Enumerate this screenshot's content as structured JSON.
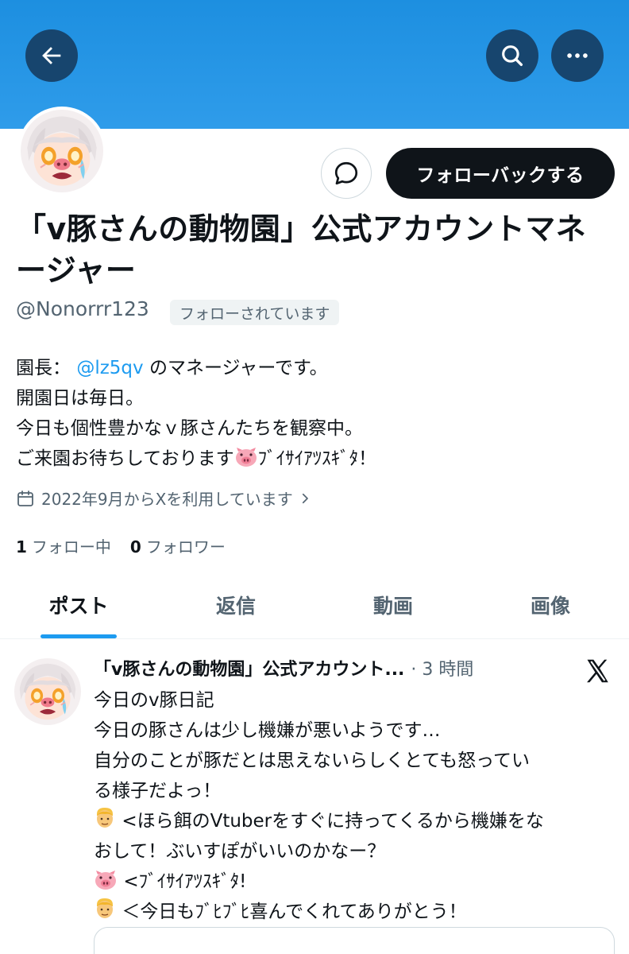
{
  "profile": {
    "display_name": "「v豚さんの動物園」公式アカウントマネージャー",
    "handle": "@Nonorrr123",
    "follows_you_badge": "フォローされています",
    "follow_back_label": "フォローバックする",
    "bio": {
      "line1_prefix": "園長：",
      "line1_mention": "@lz5qv",
      "line1_suffix": "のマネージャーです。",
      "line2": "開園日は毎日。",
      "line3": "今日も個性豊かなｖ豚さんたちを観察中。",
      "line4_prefix": "ご来園お待ちしております",
      "line4_suffix": "ﾌﾞｲｻｲｱﾂｽｷﾞﾀ！"
    },
    "joined": "2022年9月からXを利用しています",
    "following_count": "1",
    "following_label": "フォロー中",
    "followers_count": "0",
    "followers_label": "フォロワー"
  },
  "icons": {
    "back": "arrow-left-icon",
    "search": "search-icon",
    "more": "more-dots-icon",
    "message": "message-bubble-icon",
    "calendar": "calendar-icon",
    "chevron": "chevron-right-icon",
    "x_logo": "x-logo-icon"
  },
  "tabs": [
    {
      "label": "ポスト",
      "active": true
    },
    {
      "label": "返信",
      "active": false
    },
    {
      "label": "動画",
      "active": false
    },
    {
      "label": "画像",
      "active": false
    }
  ],
  "post": {
    "author": "「v豚さんの動物園」公式アカウント...",
    "meta": "· 3 時間",
    "lines": {
      "l1": "今日のv豚日記",
      "l2": "今日の豚さんは少し機嫌が悪いようです…",
      "l3": "自分のことが豚だとは思えないらしくとても怒ってい",
      "l4": "る様子だよっ！",
      "l5": "<ほら餌のVtuberをすぐに持ってくるから機嫌をな",
      "l6": "おして！ぶいすぽがいいのかなー？",
      "l7": "<ﾌﾞｲｻｲｱﾂｽｷﾞﾀ!",
      "l8": "＜今日もﾌﾞﾋﾌﾞﾋ喜んでくれてありがとう！"
    }
  },
  "colors": {
    "banner": "#1d8fe0",
    "accent": "#1d9bf0",
    "text": "#0f1419",
    "muted": "#536471"
  }
}
